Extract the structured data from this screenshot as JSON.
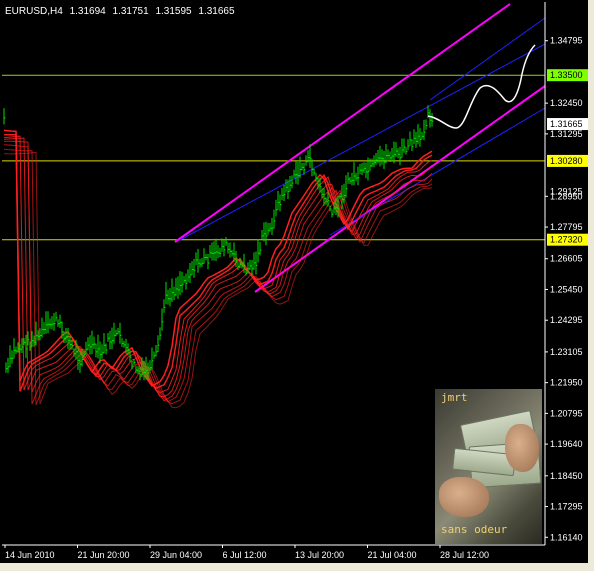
{
  "header": {
    "symbol": "EURUSD,H4",
    "open": "1.31694",
    "high": "1.31751",
    "low": "1.31595",
    "close": "1.31665"
  },
  "price_axis": {
    "labels": [
      "1.34795",
      "1.32450",
      "1.31295",
      "1.28950",
      "1.27795",
      "1.26605",
      "1.25450",
      "1.24295",
      "1.23105",
      "1.21950",
      "1.20795",
      "1.19640",
      "1.18450",
      "1.17295",
      "1.16140"
    ],
    "values": [
      1.34795,
      1.3245,
      1.31295,
      1.2895,
      1.27795,
      1.26605,
      1.2545,
      1.24295,
      1.23105,
      1.2195,
      1.20795,
      1.1964,
      1.1845,
      1.17295,
      1.1614
    ],
    "overlapped_labels": [
      "1.29125"
    ],
    "overlapped_values": [
      1.29125
    ],
    "range": [
      1.1585,
      1.3625
    ]
  },
  "time_axis": {
    "labels": [
      "14 Jun 2010",
      "21 Jun 20:00",
      "29 Jun 04:00",
      "6 Jul 12:00",
      "13 Jul 20:00",
      "21 Jul 04:00",
      "28 Jul 12:00"
    ]
  },
  "levels": [
    {
      "price": 1.335,
      "label": "1.33500",
      "color": "#9acd32",
      "tag": "#7fff00"
    },
    {
      "price": 1.3028,
      "label": "1.30280",
      "color": "#d9d900",
      "tag": "#ffff00"
    },
    {
      "price": 1.2732,
      "label": "1.27320",
      "color": "#d9d900",
      "tag": "#ffff00"
    }
  ],
  "current_price": {
    "label": "1.31665",
    "value": 1.31665
  },
  "colors": {
    "bars": "#00e000",
    "ribbon": "#ff2020",
    "channel_outer": "#ff00ff",
    "channel_inner": "#2020ff",
    "projection": "#ffffff"
  },
  "thumbnail": {
    "top_text": "jmrt",
    "bottom_text": "sans odeur"
  }
}
